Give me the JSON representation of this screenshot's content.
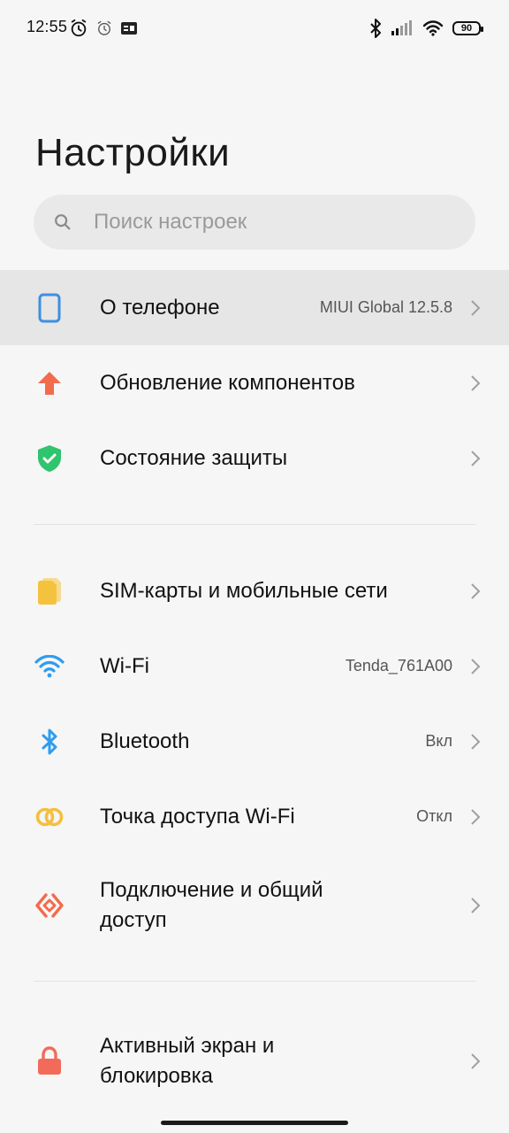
{
  "status_bar": {
    "time": "12:55",
    "battery_level": "90"
  },
  "page": {
    "title": "Настройки"
  },
  "search": {
    "placeholder": "Поиск настроек"
  },
  "items": [
    {
      "label": "О телефоне",
      "value": "MIUI Global 12.5.8",
      "icon": "phone-icon",
      "color": "#3d8fe0"
    },
    {
      "label": "Обновление компонентов",
      "value": "",
      "icon": "arrow-up-icon",
      "color": "#f26b4d"
    },
    {
      "label": "Состояние защиты",
      "value": "",
      "icon": "shield-check-icon",
      "color": "#2fc46e"
    },
    {
      "label": "SIM-карты и мобильные сети",
      "value": "",
      "icon": "sim-card-icon",
      "color": "#f5c23d"
    },
    {
      "label": "Wi-Fi",
      "value": "Tenda_761A00",
      "icon": "wifi-icon",
      "color": "#2e9df0"
    },
    {
      "label": "Bluetooth",
      "value": "Вкл",
      "icon": "bluetooth-icon",
      "color": "#2e9df0"
    },
    {
      "label": "Точка доступа Wi-Fi",
      "value": "Откл",
      "icon": "hotspot-icon",
      "color": "#f5bf3c"
    },
    {
      "label": "Подключение и общий",
      "label2": "доступ",
      "value": "",
      "icon": "share-connection-icon",
      "color": "#f26b4d"
    },
    {
      "label": "Активный экран и",
      "label2": "блокировка",
      "value": "",
      "icon": "lock-icon",
      "color": "#f26b5a"
    }
  ]
}
